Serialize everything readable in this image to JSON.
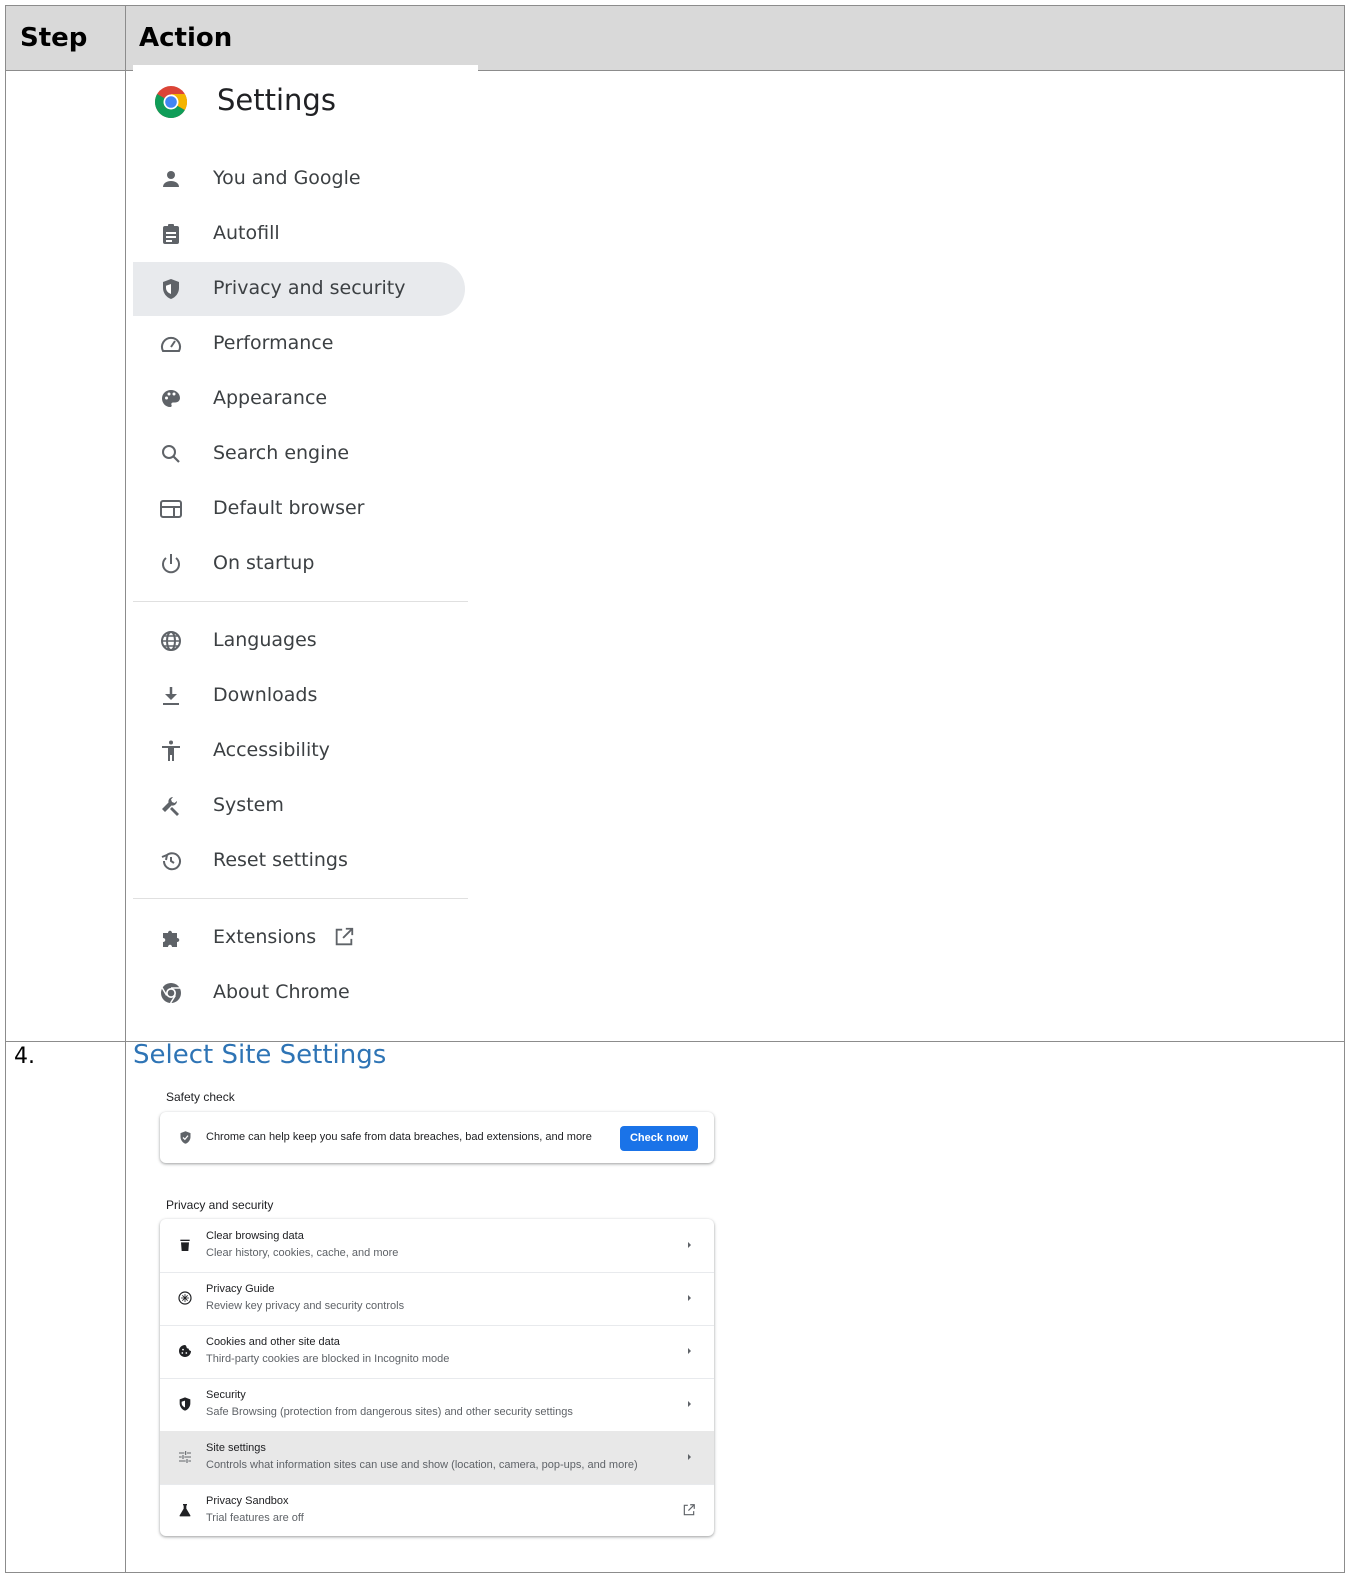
{
  "table": {
    "header_step": "Step",
    "header_action": "Action",
    "step_number": "4.",
    "step_heading": "Select Site Settings"
  },
  "settings_nav": {
    "title": "Settings",
    "items": [
      {
        "label": "You and Google",
        "icon": "person-icon"
      },
      {
        "label": "Autofill",
        "icon": "clipboard-icon"
      },
      {
        "label": "Privacy and security",
        "icon": "shield-icon",
        "active": true
      },
      {
        "label": "Performance",
        "icon": "speedometer-icon"
      },
      {
        "label": "Appearance",
        "icon": "palette-icon"
      },
      {
        "label": "Search engine",
        "icon": "search-icon"
      },
      {
        "label": "Default browser",
        "icon": "browser-window-icon"
      },
      {
        "label": "On startup",
        "icon": "power-icon"
      },
      {
        "label": "Languages",
        "icon": "globe-icon"
      },
      {
        "label": "Downloads",
        "icon": "download-icon"
      },
      {
        "label": "Accessibility",
        "icon": "accessibility-icon"
      },
      {
        "label": "System",
        "icon": "wrench-icon"
      },
      {
        "label": "Reset settings",
        "icon": "history-icon"
      },
      {
        "label": "Extensions",
        "icon": "puzzle-icon"
      },
      {
        "label": "About Chrome",
        "icon": "chrome-icon"
      }
    ]
  },
  "privacy_page": {
    "safety_check_label": "Safety check",
    "safety_text": "Chrome can help keep you safe from data breaches, bad extensions, and more",
    "check_now": "Check now",
    "privacy_label": "Privacy and security",
    "rows": [
      {
        "title": "Clear browsing data",
        "subtitle": "Clear history, cookies, cache, and more",
        "icon": "trash-icon"
      },
      {
        "title": "Privacy Guide",
        "subtitle": "Review key privacy and security controls",
        "icon": "privacy-guide-icon"
      },
      {
        "title": "Cookies and other site data",
        "subtitle": "Third-party cookies are blocked in Incognito mode",
        "icon": "cookie-icon"
      },
      {
        "title": "Security",
        "subtitle": "Safe Browsing (protection from dangerous sites) and other security settings",
        "icon": "shield-icon"
      },
      {
        "title": "Site settings",
        "subtitle": "Controls what information sites can use and show (location, camera, pop-ups, and more)",
        "icon": "sliders-icon",
        "highlighted": true
      },
      {
        "title": "Privacy Sandbox",
        "subtitle": "Trial features are off",
        "icon": "flask-icon"
      }
    ]
  },
  "colors": {
    "accent_blue": "#1a73e8",
    "heading_blue": "#2e74b5",
    "active_nav_bg": "#e8eaed"
  }
}
